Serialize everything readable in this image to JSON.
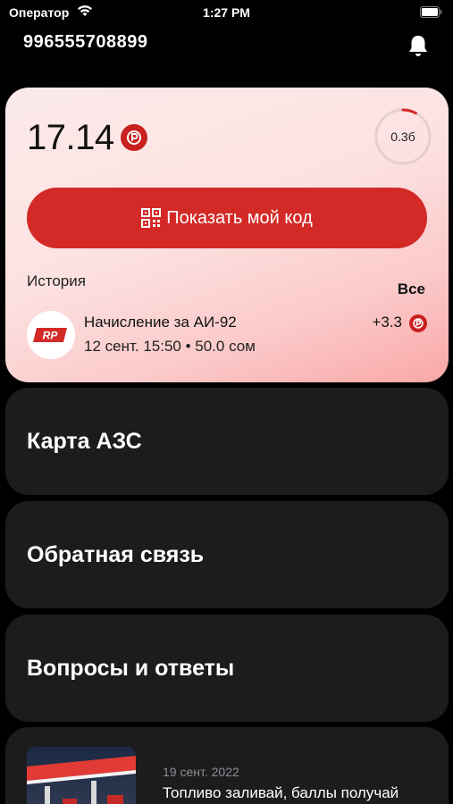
{
  "status_bar": {
    "carrier": "Оператор",
    "time": "1:27 PM"
  },
  "header": {
    "phone": "996555708899"
  },
  "balance_card": {
    "balance": "17.14",
    "progress_label": "0.3б",
    "progress_fraction": 0.08,
    "show_code_label": "Показать мой код",
    "history_title": "История",
    "history_all_label": "Все",
    "history": [
      {
        "brand": "RP",
        "name": "Начисление за АИ-92",
        "meta": "12 сент. 15:50 • 50.0 сом",
        "amount": "+3.3"
      }
    ]
  },
  "menu": {
    "items": [
      {
        "label": "Карта АЗС"
      },
      {
        "label": "Обратная связь"
      },
      {
        "label": "Вопросы и ответы"
      }
    ]
  },
  "news": {
    "date": "19 сент. 2022",
    "title": "Топливо заливай, баллы получай"
  },
  "colors": {
    "accent": "#d32a27",
    "tile_bg": "#1c1c1e"
  }
}
